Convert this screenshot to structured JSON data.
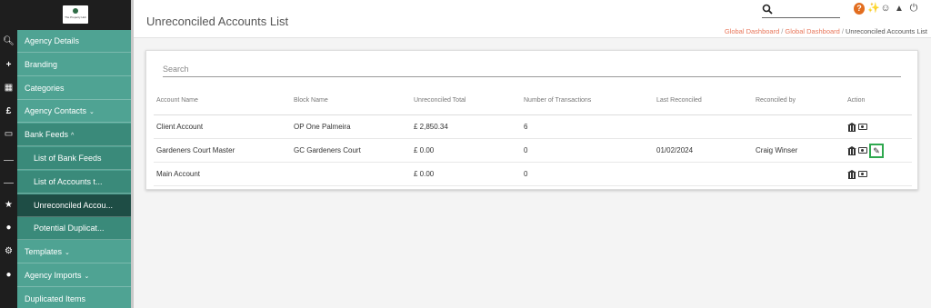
{
  "app": {
    "logo_text": "The Property Hub"
  },
  "sidebar": {
    "items": [
      {
        "label": "Agency Details",
        "icon": "search-icon"
      },
      {
        "label": "Branding",
        "icon": "plus-icon"
      },
      {
        "label": "Categories",
        "icon": "briefcase-icon"
      },
      {
        "label": "Agency Contacts",
        "icon": "pound-icon",
        "chevron": "⌄"
      },
      {
        "label": "Bank Feeds",
        "icon": "monitor-icon",
        "chevron": "^"
      },
      {
        "label": "List of Bank Feeds"
      },
      {
        "label": "List of Accounts t..."
      },
      {
        "label": "Unreconciled Accou..."
      },
      {
        "label": "Potential Duplicat..."
      },
      {
        "label": "Templates",
        "icon": "wrench-icon",
        "chevron": "⌄"
      },
      {
        "label": "Agency Imports",
        "icon": "user-icon",
        "chevron": "⌄"
      },
      {
        "label": "Duplicated Items"
      }
    ]
  },
  "header": {
    "title": "Unreconciled Accounts List",
    "breadcrumb": [
      "Global Dashboard",
      "Global Dashboard",
      "Unreconciled Accounts List"
    ],
    "icons": [
      "help-icon",
      "tag-icon",
      "smiley-icon",
      "graduation-cap-icon",
      "power-icon"
    ]
  },
  "search": {
    "placeholder": "Search",
    "value": ""
  },
  "table": {
    "columns": [
      "Account Name",
      "Block Name",
      "Unreconciled Total",
      "Number of Transactions",
      "Last Reconciled",
      "Reconciled by",
      "Action"
    ],
    "rows": [
      {
        "account": "Client Account",
        "block": "OP One Palmeira",
        "total": "£ 2,850.34",
        "transactions": "6",
        "last": "",
        "by": ""
      },
      {
        "account": "Gardeners Court Master",
        "block": "GC Gardeners Court",
        "total": "£ 0.00",
        "transactions": "0",
        "last": "01/02/2024",
        "by": "Craig Winser"
      },
      {
        "account": "Main Account",
        "block": "",
        "total": "£ 0.00",
        "transactions": "0",
        "last": "",
        "by": ""
      }
    ]
  },
  "colors": {
    "sidebar": "#4fa393",
    "sidebar_current": "#1e4d45",
    "rail": "#1e1e1e",
    "breadcrumb_link": "#e8765a",
    "help_badge": "#e26d1f",
    "edit_highlight": "#2fa84f"
  }
}
